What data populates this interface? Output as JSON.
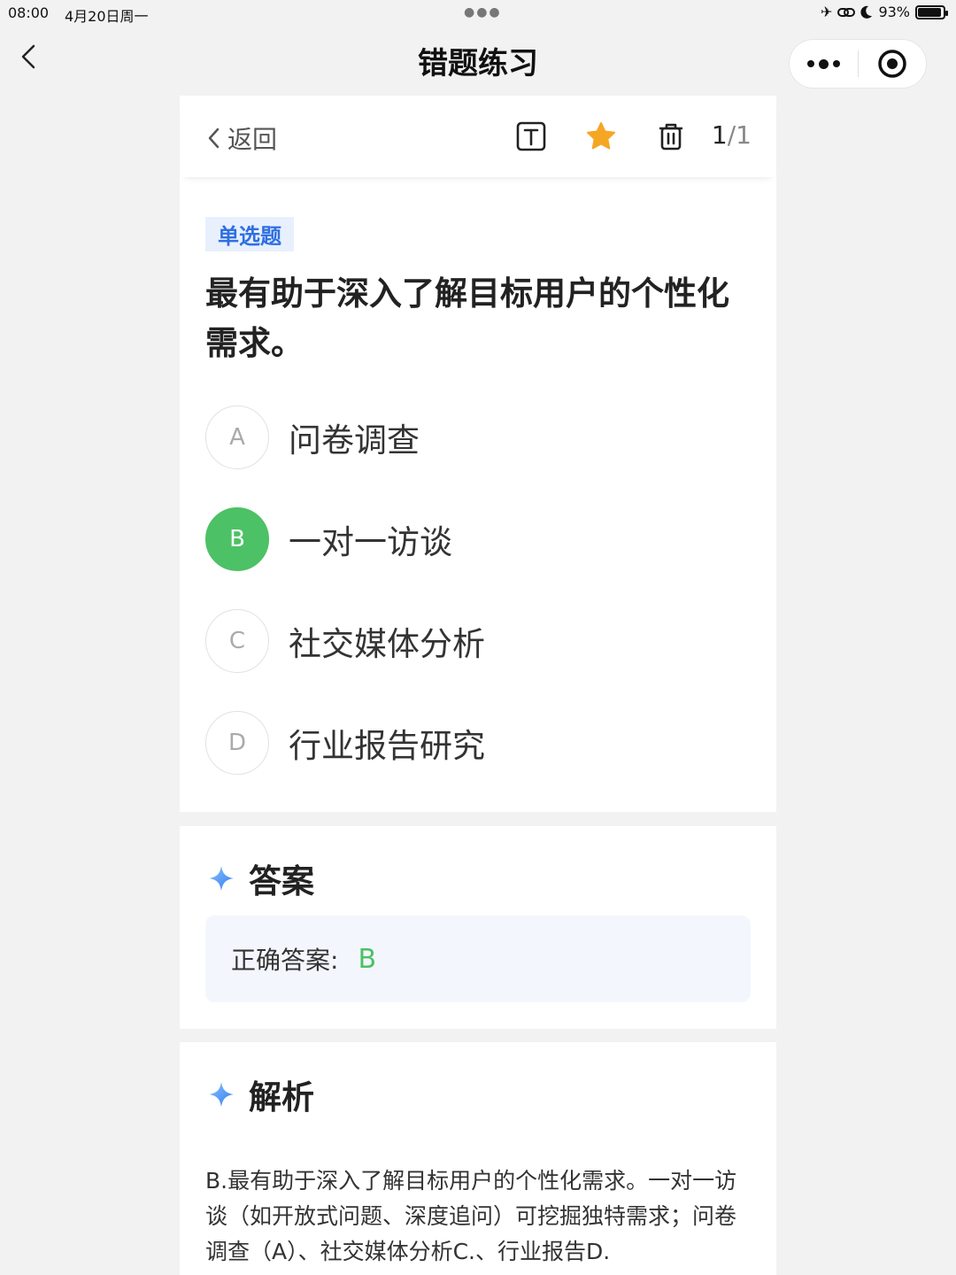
{
  "status": {
    "time": "08:00",
    "date": "4月20日周一",
    "battery": "93%",
    "battery_level": 0.93
  },
  "nav": {
    "title": "错题练习"
  },
  "toolbar": {
    "back_label": "返回",
    "page_current": "1",
    "page_total": "1",
    "icons": [
      "text-icon",
      "star-icon",
      "trash-icon"
    ],
    "star_color": "#f5a623"
  },
  "question": {
    "type": "单选题",
    "text": "最有助于深入了解目标用户的个性化需求。",
    "options": [
      {
        "letter": "A",
        "text": "问卷调查"
      },
      {
        "letter": "B",
        "text": "一对一访谈"
      },
      {
        "letter": "C",
        "text": "社交媒体分析"
      },
      {
        "letter": "D",
        "text": "行业报告研究"
      }
    ],
    "correct_color": "#4cc165"
  },
  "answer": {
    "heading": "答案",
    "label": "正确答案:",
    "value": "B"
  },
  "analysis": {
    "heading": "解析",
    "text": "B.最有助于深入了解目标用户的个性化需求。一对一访谈（如开放式问题、深度追问）可挖掘独特需求；问卷调查（A）、社交媒体分析C.、行业报告D."
  }
}
